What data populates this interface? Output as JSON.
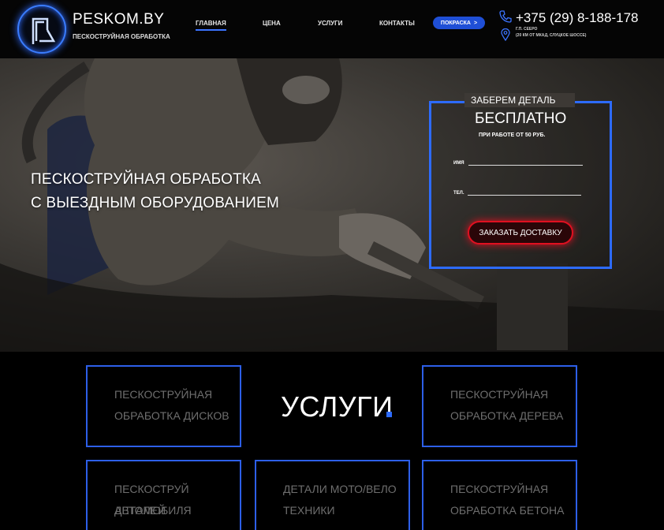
{
  "header": {
    "brand": "PESKOM.BY",
    "tagline": "ПЕСКОСТРУЙНАЯ ОБРАБОТКА",
    "nav": [
      "ГЛАВНАЯ",
      "ЦЕНА",
      "УСЛУГИ",
      "КОНТАКТЫ"
    ],
    "pill_label": "ПОКРАСКА",
    "pill_arrow": ">",
    "phone": "+375 (29) 8-188-178",
    "address_line1": "Г.П. СЕЕРО",
    "address_line2": "(20 КМ ОТ МКАД, СЛУЦКОЕ ШОССЕ)",
    "accent": "#2d6bff"
  },
  "hero": {
    "title_line1": "ПЕСКОСТРУЙНАЯ ОБРАБОТКА",
    "title_line2": "С ВЫЕЗДНЫМ ОБОРУДОВАНИЕМ"
  },
  "form": {
    "heading_top": "ЗАБЕРЕМ ДЕТАЛЬ",
    "heading_big": "БЕСПЛАТНО",
    "note": "ПРИ РАБОТЕ ОТ 50 РУБ.",
    "name_label": "ИМЯ",
    "phone_label": "ТЕЛ.",
    "button": "ЗАКАЗАТЬ ДОСТАВКУ",
    "button_color": "#e01020"
  },
  "services": {
    "heading": "УСЛУГИ",
    "cards": [
      {
        "line1": "ПЕСКОСТРУЙНАЯ",
        "line2": "ОБРАБОТКА ДИСКОВ"
      },
      {
        "line1": "ПЕСКОСТРУЙНАЯ",
        "line2": "ОБРАБОТКА ДЕРЕВА"
      },
      {
        "line1": "ПЕСКОСТРУЙ ДЕТАЛЕЙ",
        "line2": "АВТОМОБИЛЯ"
      },
      {
        "line1": "ДЕТАЛИ МОТО/ВЕЛО",
        "line2": "ТЕХНИКИ"
      },
      {
        "line1": "ПЕСКОСТРУЙНАЯ",
        "line2": "ОБРАБОТКА БЕТОНА"
      }
    ]
  }
}
